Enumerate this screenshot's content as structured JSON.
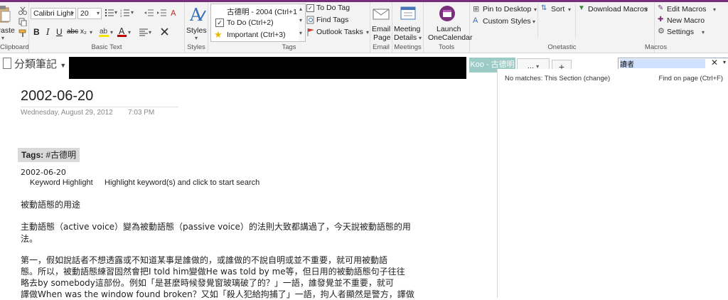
{
  "ribbon": {
    "clipboard": {
      "paste_label": "Paste",
      "group_label": "Clipboard"
    },
    "basic_text": {
      "font_name": "Calibri Light",
      "font_size": "20",
      "group_label": "Basic Text"
    },
    "styles": {
      "label": "Styles",
      "group_label": "Styles"
    },
    "tags": {
      "items": [
        "古德明 - 2004 (Ctrl+1",
        "To Do (Ctrl+2)",
        "Important (Ctrl+3)"
      ],
      "todo_tag": "To Do Tag",
      "find_tags": "Find Tags",
      "outlook_tasks": "Outlook Tasks",
      "group_label": "Tags"
    },
    "email": {
      "label1": "Email",
      "label2": "Page",
      "group_label": "Email"
    },
    "meetings": {
      "label1": "Meeting",
      "label2": "Details",
      "group_label": "Meetings"
    },
    "tools": {
      "label1": "Launch",
      "label2": "OneCalendar",
      "group_label": "Tools"
    },
    "onetastic": {
      "pin": "Pin to Desktop",
      "custom_styles": "Custom Styles",
      "sort": "Sort",
      "download_macros": "Download Macros",
      "group_label": "Onetastic"
    },
    "macros": {
      "edit": "Edit Macros",
      "new": "New Macro",
      "settings": "Settings",
      "group_label": "Macros"
    }
  },
  "notebook": {
    "name": "分類筆記"
  },
  "tabs": {
    "section": "Koo - 古德明",
    "more": "...",
    "add": "+"
  },
  "search": {
    "value": "讀者"
  },
  "results": {
    "no_matches": "No matches:  This Section (change)",
    "find_on_page": "Find on page (Ctrl+F)"
  },
  "page": {
    "title": "2002-06-20",
    "date": "Wednesday, August 29, 2012",
    "time": "7:03 PM",
    "tags_label": "Tags:",
    "tags_value": "#古德明",
    "line_date": "2002-06-20",
    "keyword_highlight": "Keyword Highlight",
    "keyword_hint": "Highlight keyword(s) and click to start search",
    "heading": "被動語態的用途",
    "para1": [
      "主動語態（active voice）變為被動語態（passive voice）的法則大致都講過了，今天說被動語態的用",
      "法。"
    ],
    "para2": [
      "第一，假如說話者不想透露或不知道某事是誰做的，或誰做的不說自明或並不重要，就可用被動語",
      "態。所以，被動語態練習固然會把I told him變做He was told by me等，但日用的被動語態句子往往",
      "略去by somebody這部份。例如「是甚麼時候發覺窗玻璃破了的？」一語，誰發覺並不重要，就可",
      "譯做When was the window found broken？又如「殺人犯給拘捕了」一語，拘人者顯然是警方，譯做"
    ]
  }
}
